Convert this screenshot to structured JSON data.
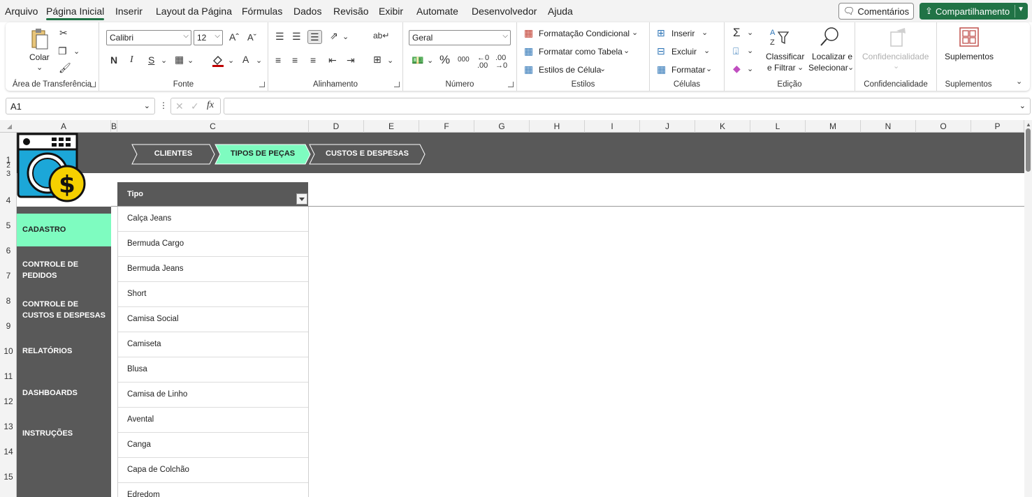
{
  "menu": {
    "tabs": [
      "Arquivo",
      "Página Inicial",
      "Inserir",
      "Layout da Página",
      "Fórmulas",
      "Dados",
      "Revisão",
      "Exibir",
      "Automate",
      "Desenvolvedor",
      "Ajuda"
    ],
    "active_tab": "Página Inicial",
    "comments_label": "Comentários",
    "share_label": "Compartilhamento"
  },
  "ribbon": {
    "clipboard": {
      "paste_label": "Colar",
      "group_label": "Área de Transferência"
    },
    "font": {
      "family": "Calibri",
      "size": "12",
      "group_label": "Fonte",
      "bold": "N",
      "italic": "I",
      "underline": "S"
    },
    "alignment": {
      "group_label": "Alinhamento"
    },
    "number": {
      "format": "Geral",
      "group_label": "Número",
      "percent": "%",
      "thousands": "000"
    },
    "styles": {
      "conditional": "Formatação Condicional",
      "as_table": "Formatar como Tabela",
      "cell_styles": "Estilos de Célula",
      "group_label": "Estilos"
    },
    "cells": {
      "insert": "Inserir",
      "delete": "Excluir",
      "format": "Formatar",
      "group_label": "Células"
    },
    "editing": {
      "sort_line1": "Classificar",
      "sort_line2": "e Filtrar",
      "find_line1": "Localizar e",
      "find_line2": "Selecionar",
      "group_label": "Edição"
    },
    "sensitivity": {
      "label": "Confidencialidade",
      "group_label": "Confidencialidade"
    },
    "addins": {
      "label": "Suplementos",
      "group_label": "Suplementos"
    }
  },
  "formula_bar": {
    "name_box": "A1",
    "fx": "fx",
    "value": ""
  },
  "columns": [
    "A",
    "B",
    "C",
    "D",
    "E",
    "F",
    "G",
    "H",
    "I",
    "J",
    "K",
    "L",
    "M",
    "N",
    "O",
    "P"
  ],
  "rows": [
    "1",
    "2",
    "3",
    "4",
    "5",
    "6",
    "7",
    "8",
    "9",
    "10",
    "11",
    "12",
    "13",
    "14",
    "15"
  ],
  "nav_tabs": [
    {
      "label": "CLIENTES",
      "active": false
    },
    {
      "label": "TIPOS DE PEÇAS",
      "active": true
    },
    {
      "label": "CUSTOS E DESPESAS",
      "active": false
    }
  ],
  "sidebar": {
    "active": "CADASTRO",
    "items": [
      {
        "line1": "CONTROLE DE",
        "line2": "PEDIDOS"
      },
      {
        "line1": "CONTROLE DE",
        "line2": "CUSTOS E DESPESAS"
      },
      {
        "line1": "RELATÓRIOS",
        "line2": ""
      },
      {
        "line1": "DASHBOARDS",
        "line2": ""
      },
      {
        "line1": "INSTRUÇÕES",
        "line2": ""
      }
    ]
  },
  "table": {
    "header": "Tipo",
    "rows": [
      "Calça Jeans",
      "Bermuda Cargo",
      "Bermuda Jeans",
      "Short",
      "Camisa Social",
      "Camiseta",
      "Blusa",
      "Camisa de Linho",
      "Avental",
      "Canga",
      "Capa de Colchão",
      "Edredom"
    ]
  },
  "colors": {
    "accent_green": "#217346",
    "mint": "#7efcc0",
    "dark_band": "#595959",
    "logo_blue": "#1ca7d8",
    "logo_yellow": "#f5d000"
  }
}
